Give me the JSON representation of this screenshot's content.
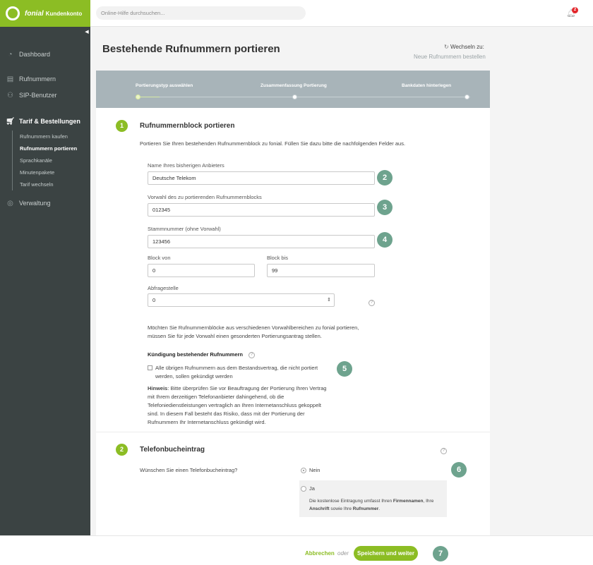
{
  "brand": {
    "name": "fonial",
    "product": "Kundenkonto"
  },
  "search": {
    "placeholder": "Online-Hilfe durchsuchen..."
  },
  "notifications": {
    "count": "2"
  },
  "sidebar": {
    "items": [
      {
        "label": "Dashboard",
        "icon": "dashboard-icon"
      },
      {
        "label": "Rufnummern",
        "icon": "phone-book-icon"
      },
      {
        "label": "SIP-Benutzer",
        "icon": "users-icon"
      },
      {
        "label": "Tarif & Bestellungen",
        "icon": "cart-icon"
      },
      {
        "label": "Verwaltung",
        "icon": "settings-icon"
      }
    ],
    "subitems": [
      "Rufnummern kaufen",
      "Rufnummern portieren",
      "Sprachkanäle",
      "Minutenpakete",
      "Tarif wechseln"
    ]
  },
  "page": {
    "title": "Bestehende Rufnummern portieren",
    "switch_label": "Wechseln zu:",
    "switch_link": "Neue Rufnummern bestellen"
  },
  "stepper": {
    "steps": [
      "Portierungstyp auswählen",
      "Zusammenfassung Portierung",
      "Bankdaten hinterlegen"
    ],
    "current": 0
  },
  "section1": {
    "num": "1",
    "title": "Rufnummernblock portieren",
    "intro": "Portieren Sie Ihren bestehenden Rufnummernblock zu fonial. Füllen Sie dazu bitte die nachfolgenden Felder aus.",
    "provider_label": "Name Ihres bisherigen Anbieters",
    "provider_value": "Deutsche Telekom",
    "prefix_label": "Vorwahl des zu portierenden Rufnummernblocks",
    "prefix_value": "012345",
    "base_label": "Stammnummer (ohne Vorwahl)",
    "base_value": "123456",
    "block_from_label": "Block von",
    "block_from_value": "0",
    "block_to_label": "Block bis",
    "block_to_value": "99",
    "query_label": "Abfragestelle",
    "query_value": "0",
    "multi_note_1": "Möchten Sie Rufnummernblöcke aus verschiedenen Vorwahlbereichen zu fonial portieren,",
    "multi_note_2": "müssen Sie für jede Vorwahl einen gesonderten Portierungsantrag stellen.",
    "cancel_heading": "Kündigung bestehender Rufnummern",
    "cancel_check_1": "Alle übrigen Rufnummern aus dem Bestandsvertrag, die nicht portiert",
    "cancel_check_2": "werden, sollen gekündigt werden",
    "hint_bold": "Hinweis",
    "hint_1": ": Bitte überprüfen Sie vor Beauftragung der Portierung Ihren Vertrag",
    "hint_2": "mit Ihrem derzeitigen Telefonanbieter dahingehend, ob die",
    "hint_3": "Telefoniedienstleistungen vertraglich an Ihren Internetanschluss gekoppelt",
    "hint_4": "sind. In diesem Fall besteht das Risiko, dass mit der Portierung der",
    "hint_5": "Rufnummern Ihr Internetanschluss gekündigt wird."
  },
  "section2": {
    "num": "2",
    "title": "Telefonbucheintrag",
    "question": "Wünschen Sie einen Telefonbucheintrag?",
    "option_no": "Nein",
    "option_yes": "Ja",
    "yes_note_a": "Die kostenlose Eintragung umfasst Ihren ",
    "yes_note_b": "Firmennamen",
    "yes_note_c": ", Ihre",
    "yes_note_d": "Anschrift",
    "yes_note_e": " sowie Ihre ",
    "yes_note_f": "Rufnummer",
    "yes_note_g": "."
  },
  "markers": [
    "2",
    "3",
    "4",
    "5",
    "6",
    "7"
  ],
  "footer": {
    "cancel": "Abbrechen",
    "or": "oder",
    "save": "Speichern und weiter"
  },
  "colors": {
    "brand_green": "#8cbd24",
    "sidebar": "#3b4343",
    "marker": "#6ea38e",
    "stepper": "#a8b4b9"
  }
}
